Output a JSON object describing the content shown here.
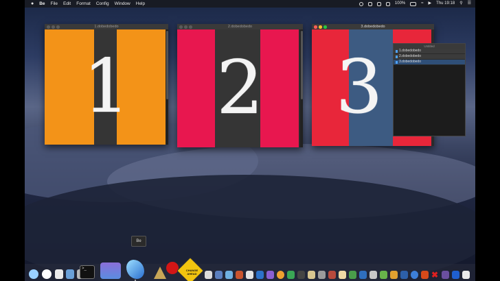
{
  "menubar": {
    "apple": "",
    "app_name": "Be",
    "menus": [
      "File",
      "Edit",
      "Format",
      "Config",
      "Window",
      "Help"
    ],
    "battery": "100%",
    "clock": "Thu 19:18"
  },
  "windows": [
    {
      "title": "1.dobedobedo",
      "digit": "1",
      "colors": [
        "#f39318",
        "#353535",
        "#f39318"
      ]
    },
    {
      "title": "2.dobedobedo",
      "digit": "2",
      "colors": [
        "#e8174f",
        "#353535",
        "#e8174f"
      ]
    },
    {
      "title": "3.dobedobedo",
      "digit": "3",
      "colors": [
        "#e8263a",
        "#3d5b82",
        "#e8263a"
      ]
    }
  ],
  "panel": {
    "title": "Untitled",
    "items": [
      "1.dobedobedo",
      "2.dobedobedo",
      "3.dobedobedo"
    ]
  },
  "dock": {
    "tooltip": "Be",
    "sign_text": "CHANGE AHEAD"
  }
}
